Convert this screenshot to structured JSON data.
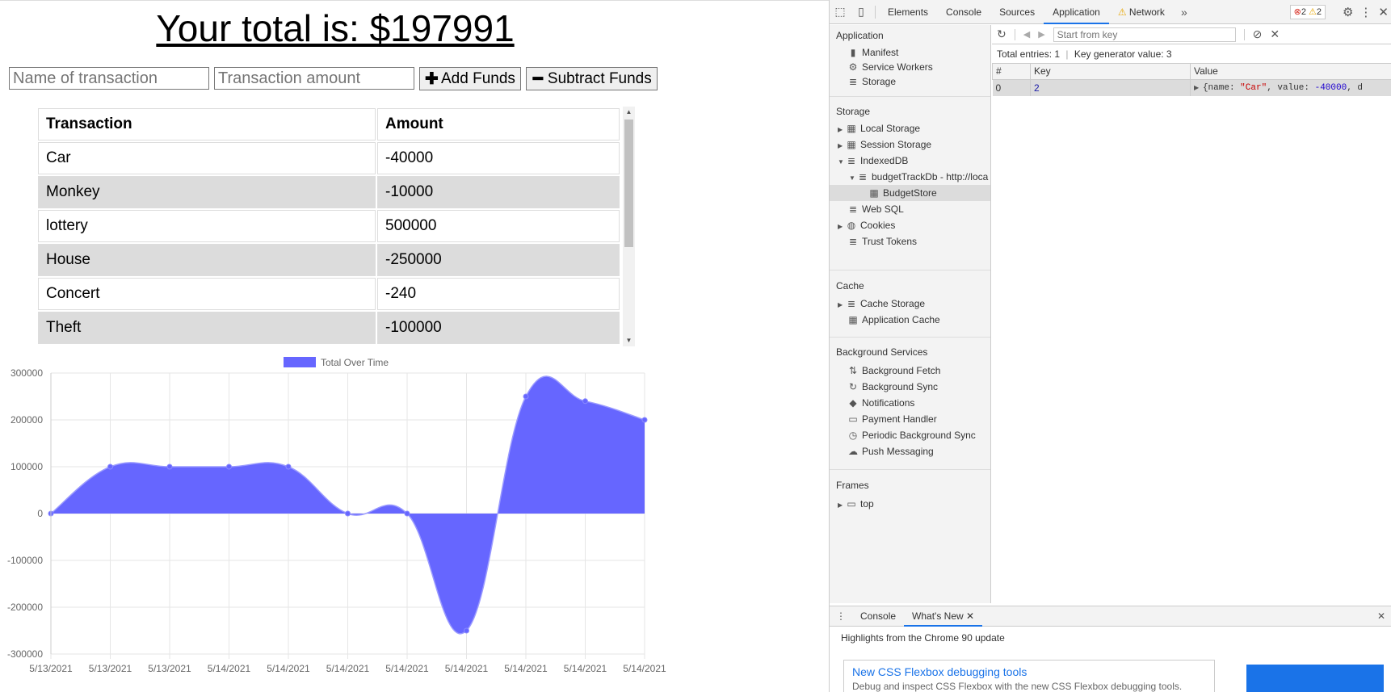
{
  "app": {
    "total_label": "Your total is: $197991",
    "name_placeholder": "Name of transaction",
    "amount_placeholder": "Transaction amount",
    "add_label": "Add Funds",
    "subtract_label": "Subtract Funds",
    "table": {
      "headers": [
        "Transaction",
        "Amount"
      ],
      "rows": [
        {
          "name": "Car",
          "amount": "-40000"
        },
        {
          "name": "Monkey",
          "amount": "-10000"
        },
        {
          "name": "lottery",
          "amount": "500000"
        },
        {
          "name": "House",
          "amount": "-250000"
        },
        {
          "name": "Concert",
          "amount": "-240"
        },
        {
          "name": "Theft",
          "amount": "-100000"
        }
      ]
    }
  },
  "chart_data": {
    "type": "area",
    "legend": "Total Over Time",
    "legend_position": "top",
    "x": [
      "5/13/2021",
      "5/13/2021",
      "5/13/2021",
      "5/14/2021",
      "5/14/2021",
      "5/14/2021",
      "5/14/2021",
      "5/14/2021",
      "5/14/2021",
      "5/14/2021",
      "5/14/2021"
    ],
    "values": [
      0,
      100000,
      100000,
      100000,
      100000,
      0,
      0,
      -250000,
      250000,
      240000,
      200000
    ],
    "ylim": [
      -300000,
      300000
    ],
    "yticks": [
      300000,
      200000,
      100000,
      0,
      -100000,
      -200000,
      -300000
    ],
    "grid": true,
    "color": "#6666ff"
  },
  "devtools": {
    "tabs": [
      "Elements",
      "Console",
      "Sources",
      "Application",
      "Network"
    ],
    "active_tab": "Application",
    "errors": "2",
    "warnings": "2",
    "sidebar": {
      "application_header": "Application",
      "application_items": [
        "Manifest",
        "Service Workers",
        "Storage"
      ],
      "storage_header": "Storage",
      "storage_items": [
        "Local Storage",
        "Session Storage",
        "IndexedDB",
        "budgetTrackDb - http://loca",
        "BudgetStore",
        "Web SQL",
        "Cookies",
        "Trust Tokens"
      ],
      "cache_header": "Cache",
      "cache_items": [
        "Cache Storage",
        "Application Cache"
      ],
      "bg_header": "Background Services",
      "bg_items": [
        "Background Fetch",
        "Background Sync",
        "Notifications",
        "Payment Handler",
        "Periodic Background Sync",
        "Push Messaging"
      ],
      "frames_header": "Frames",
      "frames_items": [
        "top"
      ]
    },
    "filter_placeholder": "Start from key",
    "summary": "Total entries: 1",
    "summary2": "Key generator value: 3",
    "table_headers": [
      "#",
      "Key",
      "Value"
    ],
    "row": {
      "index": "0",
      "key": "2",
      "value_prefix": "{name: ",
      "value_name": "\"Car\"",
      "value_mid": ", value: ",
      "value_num": "-40000",
      "value_suffix": ", d"
    },
    "drawer_tabs": [
      "Console",
      "What's New"
    ],
    "whats_new_title": "Highlights from the Chrome 90 update",
    "card_title": "New CSS Flexbox debugging tools",
    "card_desc": "Debug and inspect CSS Flexbox with the new CSS Flexbox debugging tools."
  }
}
